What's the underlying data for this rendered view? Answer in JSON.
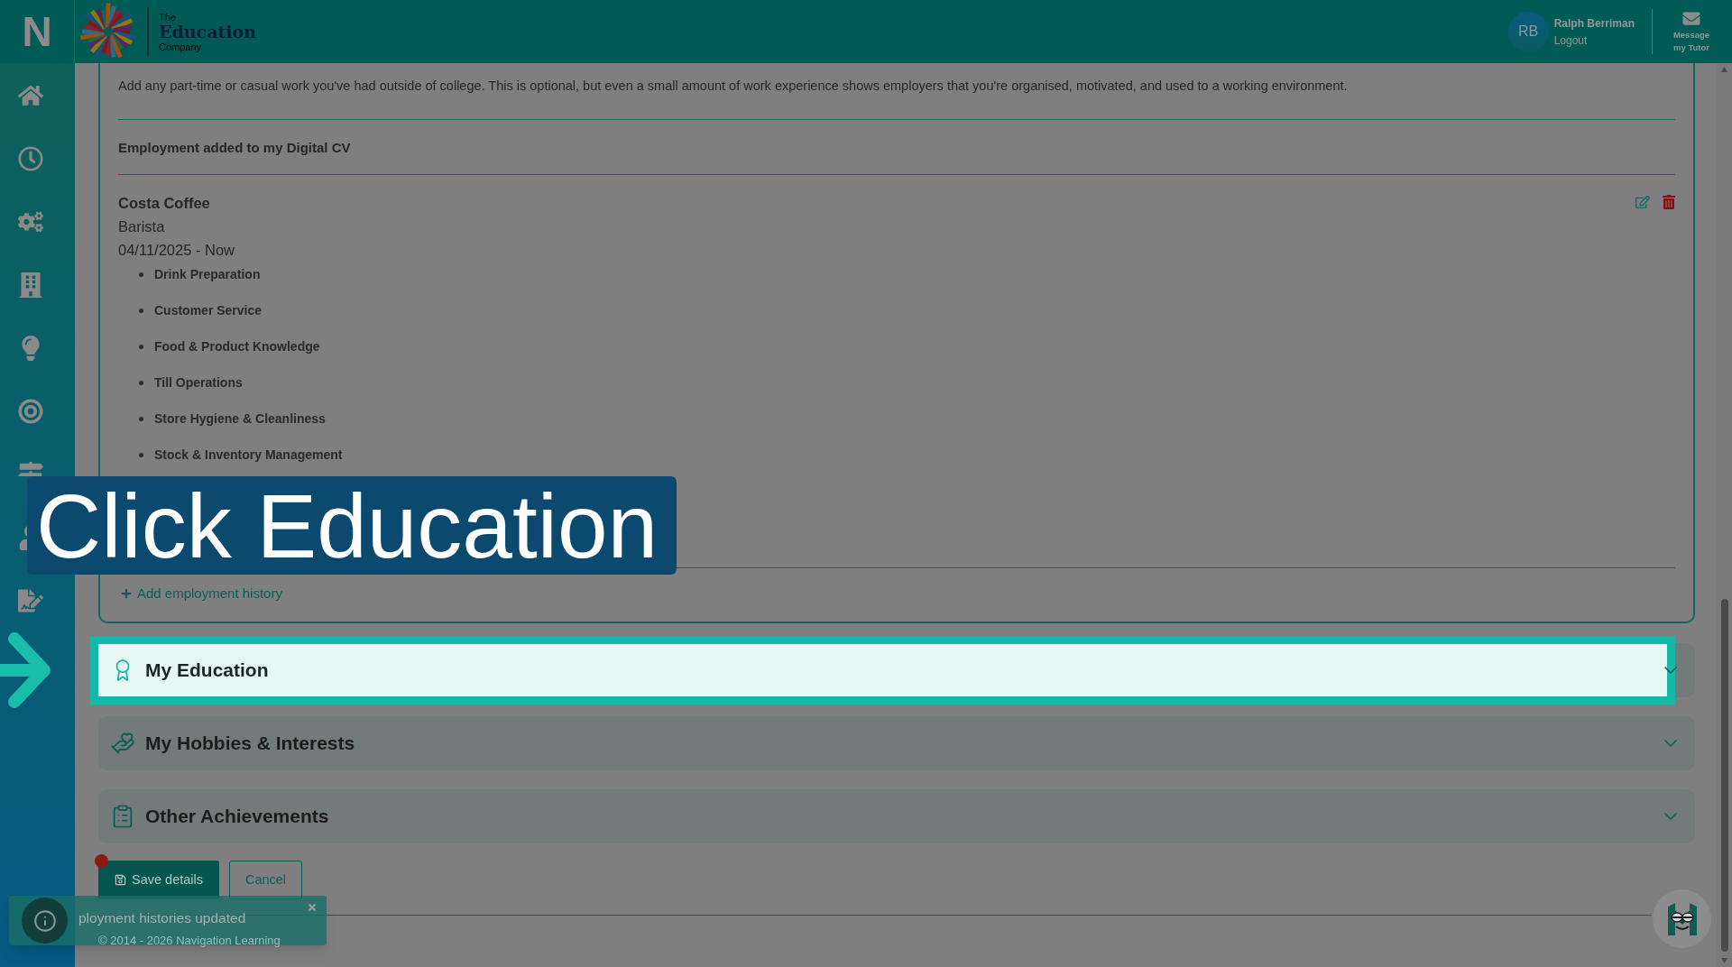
{
  "header": {
    "brand_mark": "N",
    "logo": {
      "top": "The",
      "name": "Education",
      "bottom": "Company"
    },
    "user": {
      "initials": "RB",
      "name": "Ralph Berriman",
      "logout": "Logout"
    },
    "message_button": "Message my Tutor"
  },
  "employment": {
    "intro": "Add any part-time or casual work you've had outside of college. This is optional, but even a small amount of work experience shows employers that you're organised, motivated, and used to a working environment.",
    "list_heading": "Employment added to my Digital CV",
    "entries": [
      {
        "employer": "Costa Coffee",
        "role": "Barista",
        "dates": "04/11/2025 - Now",
        "skills": [
          "Drink Preparation",
          "Customer Service",
          "Food & Product Knowledge",
          "Till Operations",
          "Store Hygiene & Cleanliness",
          "Stock & Inventory Management"
        ]
      }
    ],
    "add_link": "Add employment history"
  },
  "sections": [
    {
      "title": "My Education",
      "highlighted": true,
      "expanded": false
    },
    {
      "title": "My Hobbies & Interests",
      "highlighted": false,
      "expanded": false
    },
    {
      "title": "Other Achievements",
      "highlighted": false,
      "expanded": false
    }
  ],
  "actions": {
    "save": "Save details",
    "cancel": "Cancel",
    "alert_dot": true
  },
  "footer": {
    "copyright": "© 2014 - 2026 Navigation Learning"
  },
  "toast": {
    "message": "ployment histories updated"
  },
  "tutorial": {
    "caption": "Click Education"
  }
}
